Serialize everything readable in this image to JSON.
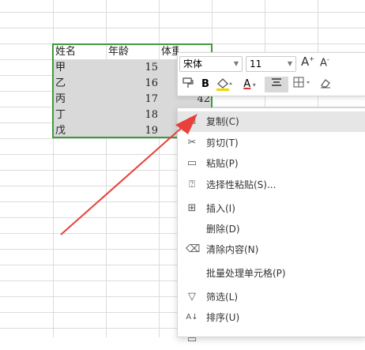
{
  "table": {
    "headers": [
      "姓名",
      "年龄",
      "体重"
    ],
    "rows": [
      {
        "name": "甲",
        "age": "15",
        "weight": ""
      },
      {
        "name": "乙",
        "age": "16",
        "weight": ""
      },
      {
        "name": "丙",
        "age": "17",
        "weight": "42"
      },
      {
        "name": "丁",
        "age": "18",
        "weight": ""
      },
      {
        "name": "戊",
        "age": "19",
        "weight": ""
      }
    ]
  },
  "toolbar": {
    "font_name": "宋体",
    "font_size": "11",
    "increase_font_label": "A",
    "decrease_font_label": "A",
    "bold_label": "B",
    "font_color_label": "A"
  },
  "context_menu": {
    "items": [
      {
        "label": "复制(C)",
        "icon": "copy-icon"
      },
      {
        "label": "剪切(T)",
        "icon": "scissors-icon"
      },
      {
        "label": "粘贴(P)",
        "icon": "paste-icon"
      },
      {
        "label": "选择性粘贴(S)...",
        "icon": "paste-special-icon"
      },
      {
        "label": "插入(I)",
        "icon": "insert-icon"
      },
      {
        "label": "删除(D)",
        "icon": ""
      },
      {
        "label": "清除内容(N)",
        "icon": "eraser-icon"
      },
      {
        "label": "批量处理单元格(P)",
        "icon": ""
      },
      {
        "label": "筛选(L)",
        "icon": "filter-icon"
      },
      {
        "label": "排序(U)",
        "icon": "sort-icon"
      }
    ]
  },
  "colors": {
    "selection_border": "#3d9c3d",
    "cell_shading": "#d9d9d9",
    "arrow": "#e8403a",
    "highlight_row": "#e6e6e6"
  }
}
